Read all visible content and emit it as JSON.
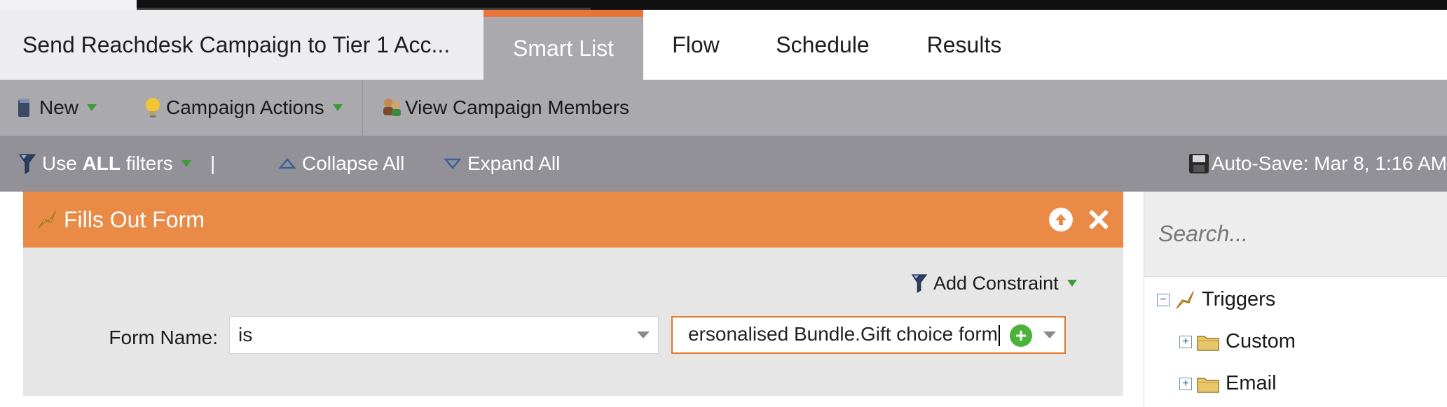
{
  "tabs": {
    "campaign_title": "Send Reachdesk Campaign to Tier 1 Acc...",
    "smart_list": "Smart List",
    "flow": "Flow",
    "schedule": "Schedule",
    "results": "Results"
  },
  "toolbar": {
    "new_label": "New",
    "campaign_actions_label": "Campaign Actions",
    "view_members_label": "View Campaign Members"
  },
  "filterbar": {
    "use_label": "Use",
    "all_label": "ALL",
    "filters_label": "filters",
    "separator": "|",
    "collapse_all": "Collapse All",
    "expand_all": "Expand All",
    "autosave": "Auto-Save: Mar 8, 1:16 AM"
  },
  "filter": {
    "title": "Fills Out Form",
    "add_constraint": "Add Constraint",
    "field_label": "Form Name:",
    "operator": "is",
    "value": "ersonalised Bundle.Gift choice form"
  },
  "sidebar": {
    "search_placeholder": "Search...",
    "tree": [
      {
        "label": "Triggers",
        "expander": "−"
      },
      {
        "label": "Custom",
        "expander": "+"
      },
      {
        "label": "Email",
        "expander": "+"
      }
    ]
  },
  "colors": {
    "accent_orange": "#e98a47",
    "active_tab": "#a9a9ae",
    "green": "#4bb33a"
  }
}
